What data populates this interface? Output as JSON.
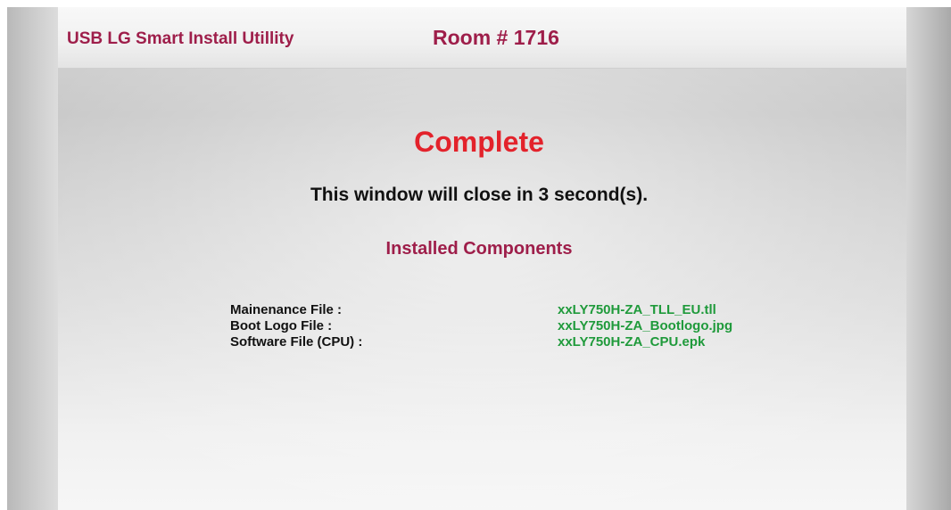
{
  "header": {
    "app_title": "USB LG Smart Install Utillity",
    "room_label": "Room # 1716"
  },
  "status": {
    "title": "Complete",
    "countdown": "This window will close in 3 second(s)."
  },
  "components": {
    "heading": "Installed Components",
    "items": [
      {
        "label": "Mainenance File :",
        "value": "xxLY750H-ZA_TLL_EU.tll"
      },
      {
        "label": "Boot Logo File :",
        "value": "xxLY750H-ZA_Bootlogo.jpg"
      },
      {
        "label": "Software File (CPU) :",
        "value": "xxLY750H-ZA_CPU.epk"
      }
    ]
  },
  "colors": {
    "accent": "#9e1e4a",
    "status": "#e3222b",
    "value_text": "#1f9a3b"
  }
}
